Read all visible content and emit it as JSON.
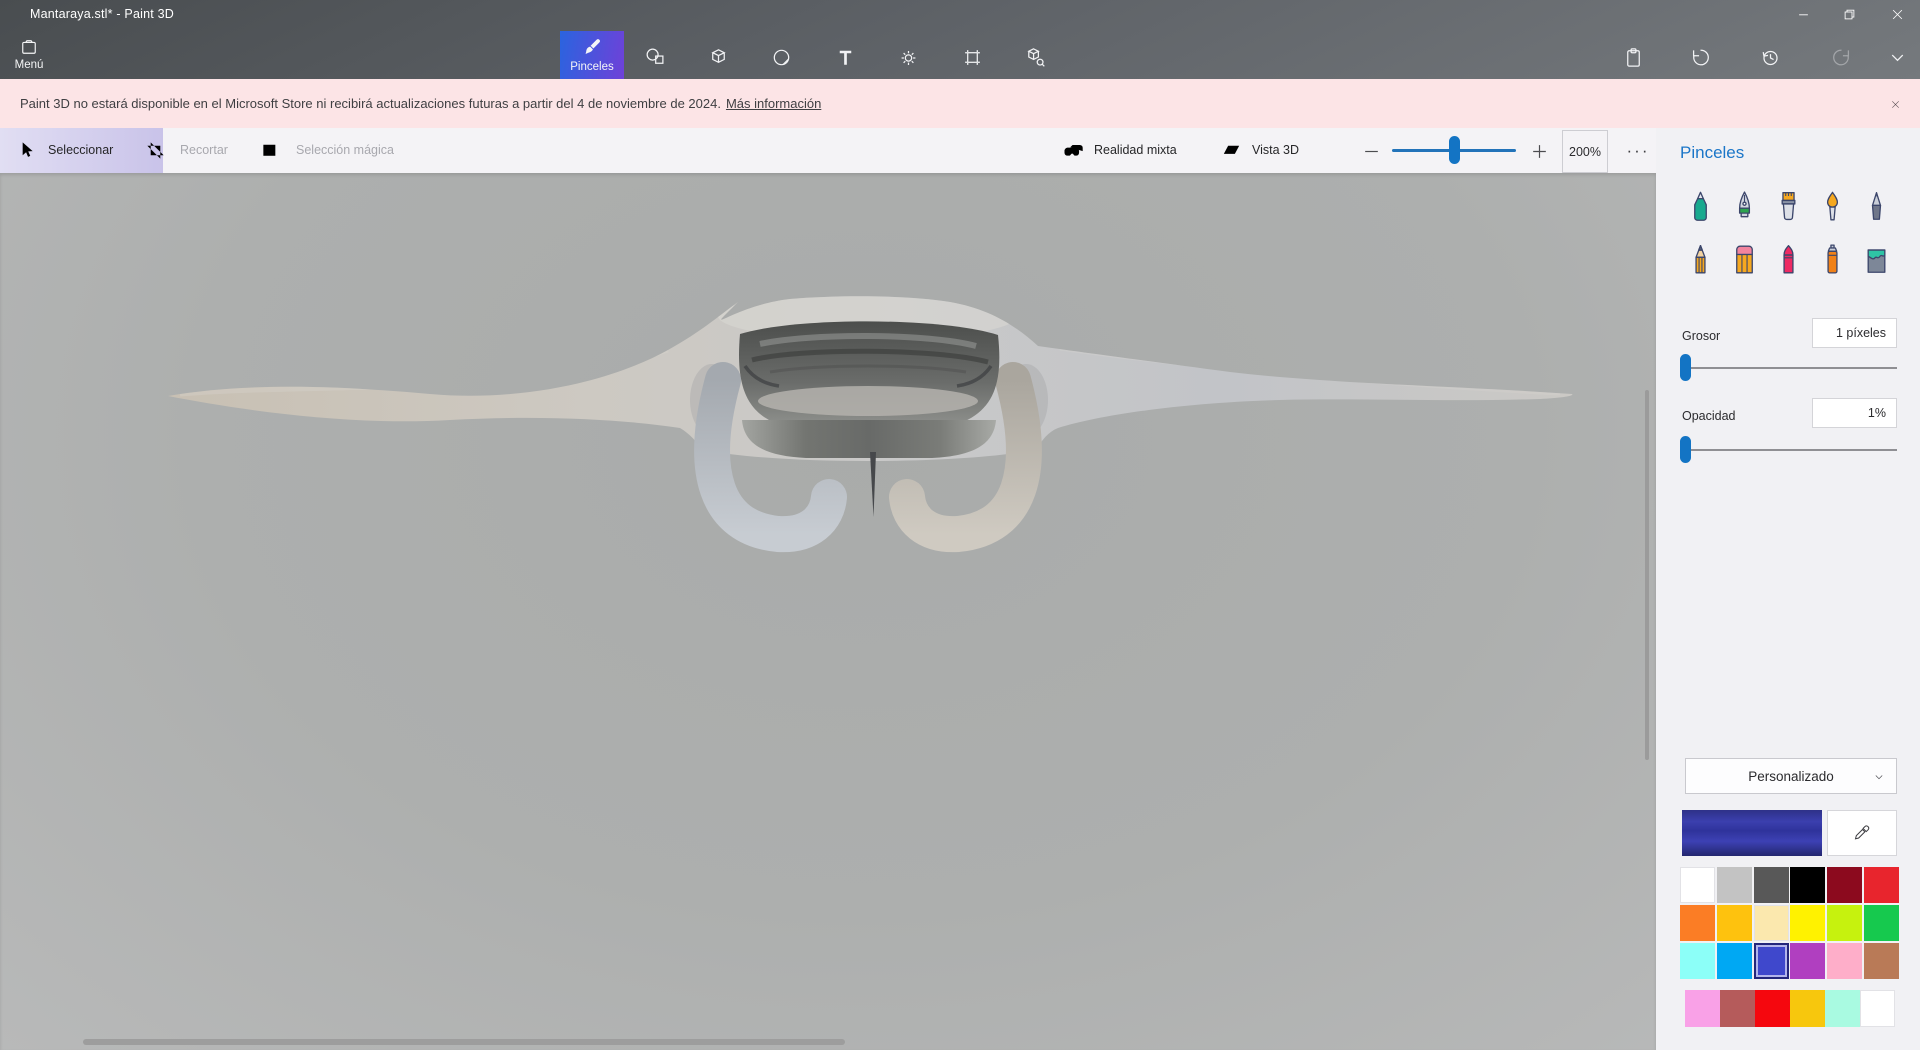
{
  "window": {
    "title": "Mantaraya.stl* - Paint 3D"
  },
  "header": {
    "menu_label": "Menú",
    "tabs": [
      {
        "id": "brushes",
        "label": "Pinceles",
        "icon": "i-brush",
        "selected": true
      },
      {
        "id": "shapes-2d",
        "icon": "i-2d",
        "selected": false
      },
      {
        "id": "shapes-3d",
        "icon": "i-cube",
        "selected": false
      },
      {
        "id": "stickers",
        "icon": "i-sticker",
        "selected": false
      },
      {
        "id": "text",
        "icon": "i-text",
        "selected": false
      },
      {
        "id": "effects",
        "icon": "i-sun",
        "selected": false
      },
      {
        "id": "canvas",
        "icon": "i-frame",
        "selected": false
      },
      {
        "id": "3d-library",
        "icon": "i-library",
        "selected": false
      }
    ],
    "right_buttons": [
      {
        "id": "paste",
        "icon": "i-paste",
        "enabled": true
      },
      {
        "id": "undo",
        "icon": "i-undo",
        "enabled": true
      },
      {
        "id": "history",
        "icon": "i-history",
        "enabled": true
      },
      {
        "id": "redo",
        "icon": "i-redo",
        "enabled": false
      },
      {
        "id": "expand",
        "icon": "i-chevron",
        "enabled": true
      }
    ]
  },
  "banner": {
    "message": "Paint 3D no estará disponible en el Microsoft Store ni recibirá actualizaciones futuras a partir del 4 de noviembre de 2024.",
    "link_label": "Más información"
  },
  "toolbar": {
    "select_label": "Seleccionar",
    "crop_label": "Recortar",
    "magic_select_label": "Selección mágica",
    "mixed_reality_label": "Realidad mixta",
    "view_3d_label": "Vista 3D",
    "zoom_value": "200%",
    "more_label": "···"
  },
  "panel": {
    "title": "Pinceles",
    "brushes": [
      "b-marker",
      "b-calligraphy",
      "b-oil",
      "b-watercolor",
      "b-pixelpen",
      "b-pencil",
      "b-eraser",
      "b-crayon",
      "b-spray",
      "b-fill"
    ],
    "thickness": {
      "label": "Grosor",
      "value": "1 píxeles"
    },
    "opacity": {
      "label": "Opacidad",
      "value": "1%"
    },
    "palette_mode": "Personalizado",
    "current_color": "#32369e",
    "selected_color": "#3f48cc",
    "colors": [
      [
        "#ffffff",
        "#c3c3c3",
        "#585858",
        "#000000",
        "#8c0a1e",
        "#e8252d"
      ],
      [
        "#fb7d25",
        "#fec20e",
        "#fbe8ae",
        "#fff200",
        "#c6f20e",
        "#16c94e"
      ],
      [
        "#8cfff8",
        "#00a8f3",
        "#3f48cc",
        "#b03fc0",
        "#feaec9",
        "#b97a57"
      ]
    ],
    "recent_colors": [
      "#f9a1e7",
      "#b55b5b",
      "#f5070e",
      "#f7c70d",
      "#a9fae1",
      "#ffffff"
    ]
  },
  "canvas": {
    "model": "manta-ray-3d-model"
  }
}
